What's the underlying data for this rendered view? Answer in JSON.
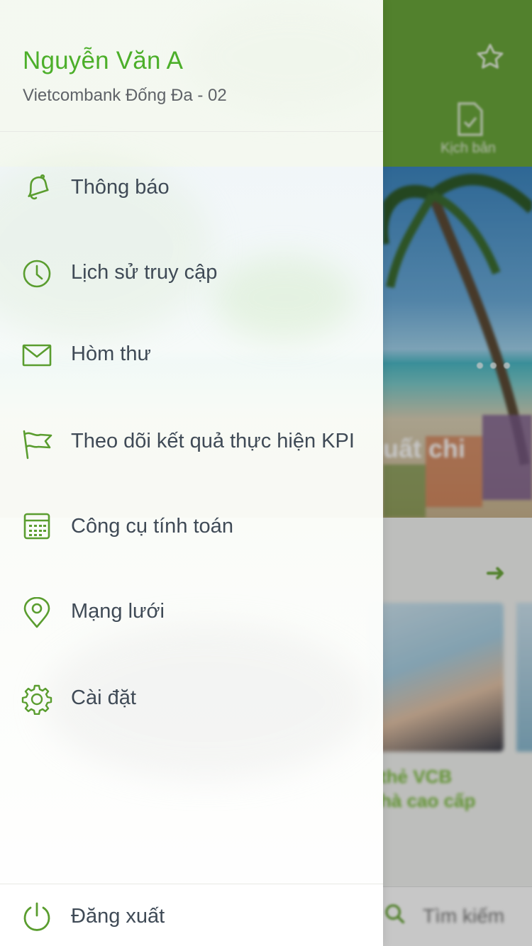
{
  "profile": {
    "name": "Nguyễn Văn A",
    "branch": "Vietcombank Đống Đa - 02"
  },
  "menu": {
    "items": [
      {
        "label": "Thông báo",
        "icon": "bell-icon"
      },
      {
        "label": "Lịch sử truy cập",
        "icon": "clock-icon"
      },
      {
        "label": "Hòm thư",
        "icon": "mail-icon"
      },
      {
        "label": "Theo dõi kết quả thực hiện KPI",
        "icon": "flag-icon"
      },
      {
        "label": "Công cụ tính toán",
        "icon": "calculator-icon"
      },
      {
        "label": "Mạng lưới",
        "icon": "map-pin-icon"
      },
      {
        "label": "Cài đặt",
        "icon": "gear-icon"
      }
    ],
    "logout_label": "Đăng xuất",
    "logout_icon": "power-icon"
  },
  "background": {
    "tab_label": "Kịch bản",
    "banner_text": "uất chi",
    "card_text_1": "thẻ VCB",
    "card_text_2": "hà cao cấp",
    "search_label": "Tìm kiếm"
  },
  "colors": {
    "accent": "#4caf2a",
    "header_green": "#6aa63a",
    "menu_text": "#3f4a56"
  }
}
